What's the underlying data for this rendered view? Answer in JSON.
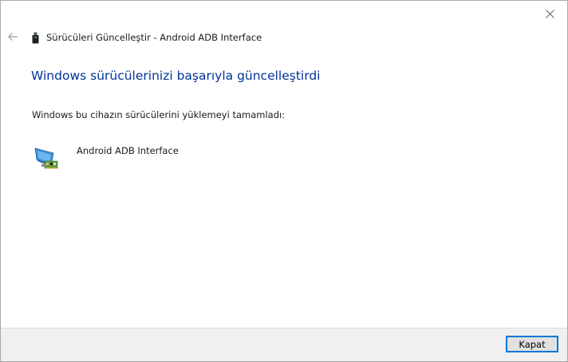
{
  "window": {
    "title": "Sürücüleri Güncelleştir - Android ADB Interface",
    "close_icon": "close-icon",
    "back_icon": "back-arrow-icon",
    "usb_icon": "usb-device-icon"
  },
  "main": {
    "headline": "Windows sürücülerinizi başarıyla güncelleştirdi",
    "subtext": "Windows bu cihazın sürücülerini yüklemeyi tamamladı:",
    "device": {
      "icon": "network-adapter-icon",
      "name": "Android ADB Interface"
    }
  },
  "footer": {
    "close_label": "Kapat"
  },
  "colors": {
    "headline": "#003399",
    "accent": "#0078d7",
    "footer_bg": "#f0f0f0"
  }
}
